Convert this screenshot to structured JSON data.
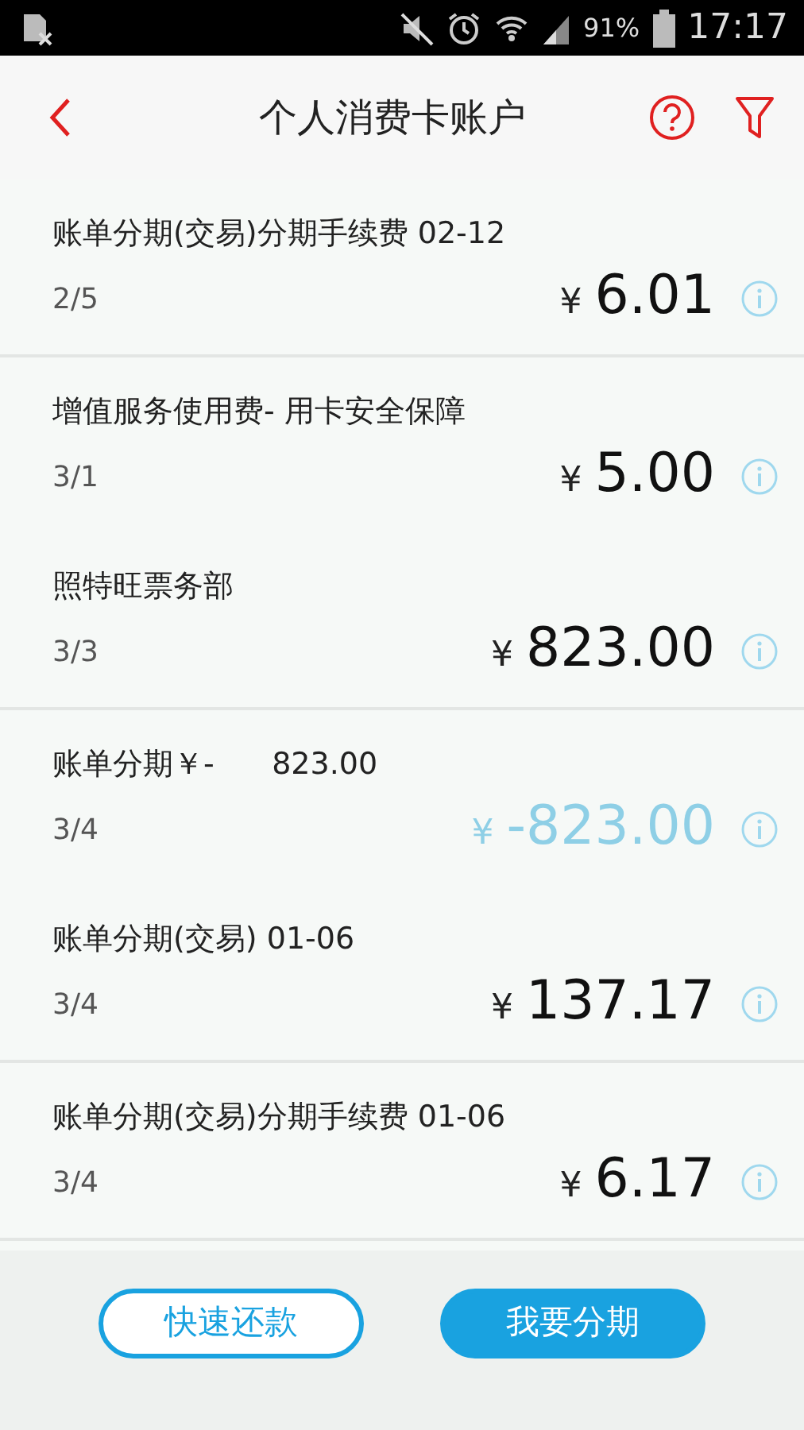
{
  "status_bar": {
    "battery": "91%",
    "time": "17:17"
  },
  "header": {
    "title": "个人消费卡账户"
  },
  "groups": [
    {
      "items": [
        {
          "title": "账单分期(交易)分期手续费 02-12",
          "date": "2/5",
          "currency": "¥",
          "amount": "6.01",
          "kind": "debit"
        }
      ]
    },
    {
      "items": [
        {
          "title": "增值服务使用费- 用卡安全保障",
          "date": "3/1",
          "currency": "¥",
          "amount": "5.00",
          "kind": "debit"
        },
        {
          "title": "照特旺票务部",
          "date": "3/3",
          "currency": "¥",
          "amount": "823.00",
          "kind": "debit"
        }
      ]
    },
    {
      "items": [
        {
          "title": "账单分期￥-      823.00",
          "date": "3/4",
          "currency": "¥",
          "amount": "-823.00",
          "kind": "credit"
        },
        {
          "title": "账单分期(交易) 01-06",
          "date": "3/4",
          "currency": "¥",
          "amount": "137.17",
          "kind": "debit"
        }
      ]
    },
    {
      "items": [
        {
          "title": "账单分期(交易)分期手续费 01-06",
          "date": "3/4",
          "currency": "¥",
          "amount": "6.17",
          "kind": "debit"
        }
      ]
    }
  ],
  "buttons": [
    {
      "label": "快速还款",
      "kind": "outline"
    },
    {
      "label": "我要分期",
      "kind": "filled"
    }
  ]
}
